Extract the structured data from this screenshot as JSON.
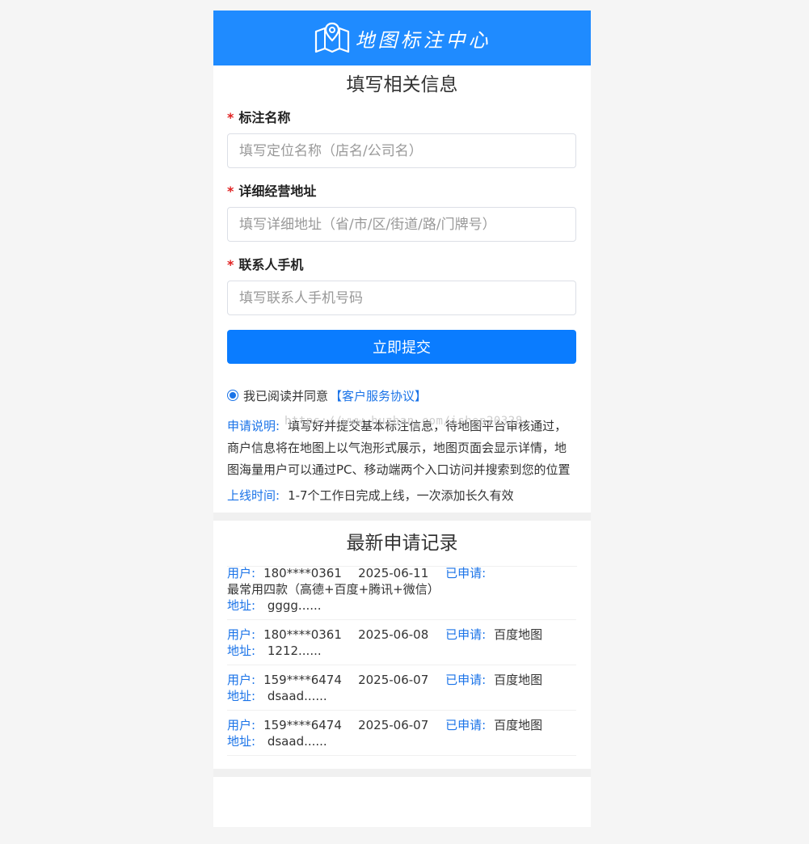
{
  "header": {
    "brand": "地图标注中心",
    "logo_icon": "map-pin-icon"
  },
  "form": {
    "title": "填写相关信息",
    "fields": [
      {
        "label": "标注名称",
        "placeholder": "填写定位名称（店名/公司名）",
        "value": ""
      },
      {
        "label": "详细经营地址",
        "placeholder": "填写详细地址（省/市/区/街道/路/门牌号）",
        "value": ""
      },
      {
        "label": "联系人手机",
        "placeholder": "填写联系人手机号码",
        "value": ""
      }
    ],
    "required_mark": "*",
    "submit_label": "立即提交",
    "agree_text": "我已阅读并同意",
    "agreement_link": "【客户服务协议】"
  },
  "watermark": "https://www.huzhan.com/ishop20328",
  "notice": {
    "apply_label": "申请说明:",
    "apply_text": "填写好并提交基本标注信息，待地图平台审核通过，商户信息将在地图上以气泡形式展示，地图页面会显示详情，地图海量用户可以通过PC、移动端两个入口访问并搜索到您的位置",
    "online_label": "上线时间:",
    "online_text": "1-7个工作日完成上线，一次添加长久有效"
  },
  "records": {
    "title": "最新申请记录",
    "user_label": "用户:",
    "applied_label": "已申请:",
    "address_label": "地址:",
    "items": [
      {
        "phone": "180****0361",
        "date": "2025-06-11",
        "platform": "",
        "platform_line2": "最常用四款（高德+百度+腾讯+微信）",
        "address": "gggg......"
      },
      {
        "phone": "180****0361",
        "date": "2025-06-08",
        "platform": "百度地图",
        "platform_line2": "",
        "address": "1212......"
      },
      {
        "phone": "159****6474",
        "date": "2025-06-07",
        "platform": "百度地图",
        "platform_line2": "",
        "address": "dsaad......"
      },
      {
        "phone": "159****6474",
        "date": "2025-06-07",
        "platform": "百度地图",
        "platform_line2": "",
        "address": "dsaad......"
      }
    ]
  },
  "colors": {
    "header_bg": "#1f8bff",
    "button_bg": "#0a7cff",
    "link": "#1a73e8",
    "required": "#e02020"
  }
}
